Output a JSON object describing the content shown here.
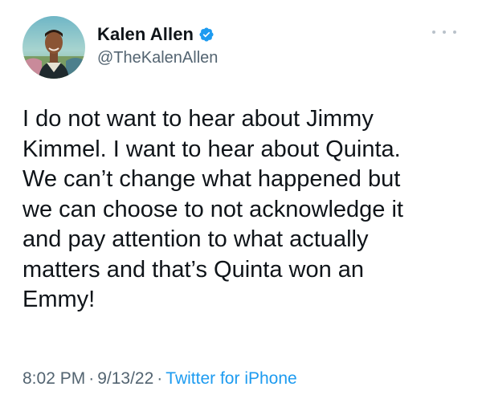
{
  "author": {
    "display_name": "Kalen Allen",
    "handle": "@TheKalenAllen",
    "verified": true
  },
  "tweet": {
    "text": "I do not want to hear about Jimmy\nKimmel. I want to hear about Quinta.\nWe can’t change what happened but\nwe can choose to not acknowledge it\nand pay attention to what actually\nmatters and that’s Quinta won an\nEmmy!"
  },
  "meta": {
    "time": "8:02 PM",
    "separator": "·",
    "date": "9/13/22",
    "source": "Twitter for iPhone"
  },
  "colors": {
    "verified": "#1d9bf0",
    "link": "#1d9bf0",
    "secondary_text": "#536471",
    "primary_text": "#0f1419"
  },
  "icons": {
    "more": "more-dots-icon",
    "verified": "verified-badge-icon"
  }
}
